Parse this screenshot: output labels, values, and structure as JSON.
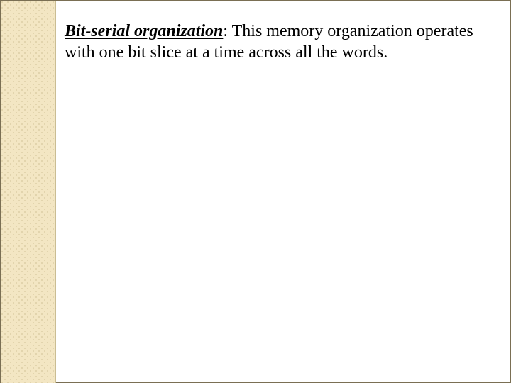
{
  "slide": {
    "term": "Bit-serial organization",
    "definition": ": This memory organization operates with one bit slice at a time across all the words."
  }
}
